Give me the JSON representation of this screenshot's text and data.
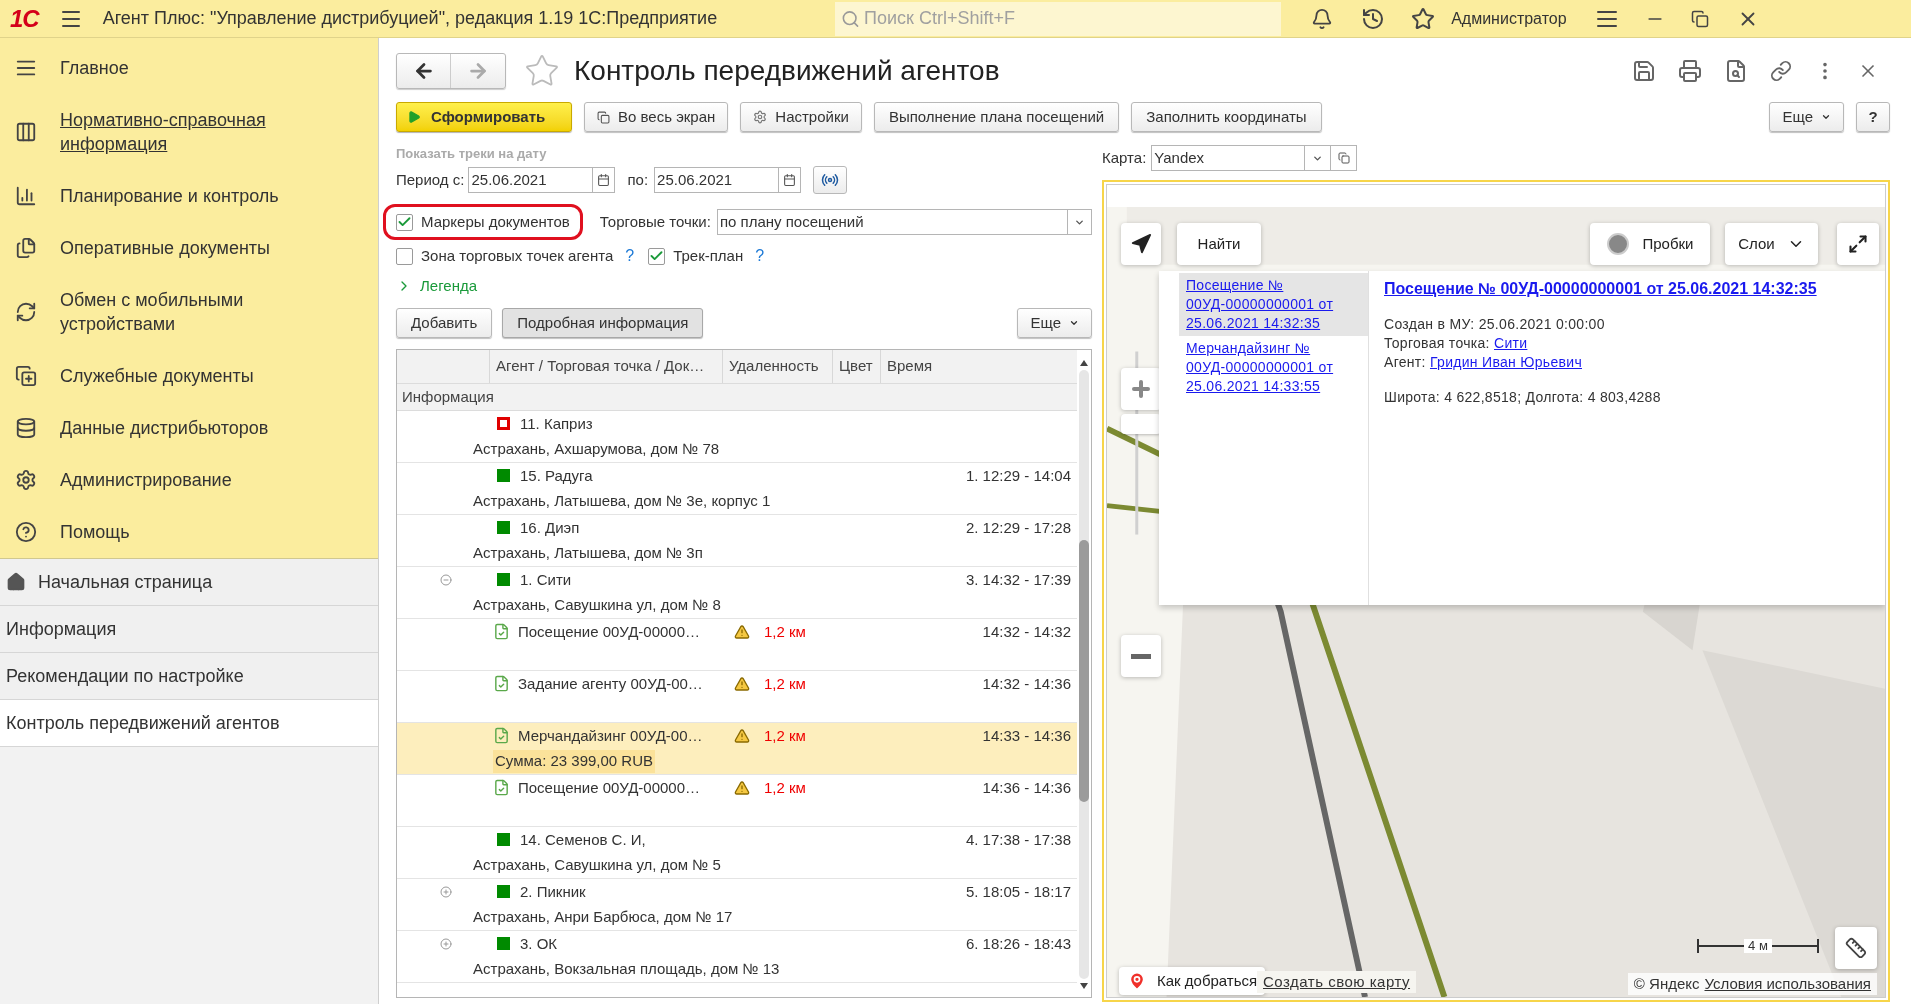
{
  "app_bar": {
    "logo": "1С",
    "title": "Агент Плюс: \"Управление дистрибуцией\", редакция 1.19 1С:Предприятие",
    "search": {
      "placeholder": "Поиск Ctrl+Shift+F"
    },
    "user": "Администратор"
  },
  "sidebar": {
    "sections": [
      {
        "label": "Главное",
        "underlined": false
      },
      {
        "label": "Нормативно-справочная информация",
        "underlined": true
      },
      {
        "label": "Планирование и контроль",
        "underlined": false
      },
      {
        "label": "Оперативные документы",
        "underlined": false
      },
      {
        "label": "Обмен с мобильными устройствами",
        "underlined": false
      },
      {
        "label": "Служебные документы",
        "underlined": false
      },
      {
        "label": "Данные дистрибьюторов",
        "underlined": false
      },
      {
        "label": "Администрирование",
        "underlined": false
      },
      {
        "label": "Помощь",
        "underlined": false
      }
    ],
    "open_pages": [
      {
        "label": "Начальная страница",
        "kind": "home",
        "selected": false
      },
      {
        "label": "Информация",
        "kind": "page",
        "selected": false
      },
      {
        "label": "Рекомендации по настройке",
        "kind": "page",
        "selected": false
      },
      {
        "label": "Контроль передвижений агентов",
        "kind": "page",
        "selected": true
      }
    ]
  },
  "form": {
    "title": "Контроль передвижений агентов",
    "favorite": false,
    "toolbar": [
      {
        "label": "Сформировать",
        "kind": "primary"
      },
      {
        "label": "Во весь экран",
        "kind": "window"
      },
      {
        "label": "Настройки",
        "kind": "settings"
      },
      {
        "label": "Выполнение плана посещений",
        "kind": "plain"
      },
      {
        "label": "Заполнить координаты",
        "kind": "plain"
      }
    ],
    "more": "Еще",
    "help": "?",
    "filters": {
      "caption": "Показать треки на дату",
      "from_label": "Период с:",
      "from_value": "25.06.2021",
      "to_label": "по:",
      "to_value": "25.06.2021",
      "checkboxes": [
        {
          "label": "Маркеры документов",
          "checked": true,
          "highlighted": true
        },
        {
          "label": "Зона торговых точек агента",
          "checked": false,
          "highlighted": false,
          "hint": "?"
        },
        {
          "label": "Трек-план",
          "checked": true,
          "highlighted": false,
          "hint": "?"
        }
      ],
      "points_label": "Торговые точки:",
      "points_value": "по плану посещений"
    },
    "legend": {
      "label": "Легенда",
      "expanded": false
    },
    "table_toolbar": [
      {
        "label": "Добавить",
        "pressed": false
      },
      {
        "label": "Подробная информация",
        "pressed": true
      }
    ],
    "table_more": "Еще",
    "table": {
      "columns": [
        "Агент / Торговая точка / Док…",
        "Удаленность",
        "Цвет",
        "Время"
      ],
      "group": "Информация",
      "rows": [
        {
          "kind": "point",
          "name": "11. Каприз",
          "address": "Астрахань, Ахшарумова, дом № 78",
          "time": "",
          "filled": false,
          "color": "#e00000"
        },
        {
          "kind": "point",
          "name": "15. Радуга",
          "address": "Астрахань, Латышева, дом № 3е, корпус 1",
          "time": "1. 12:29 - 14:04",
          "filled": true,
          "color": "#008a00"
        },
        {
          "kind": "point",
          "name": "16. Диэп",
          "address": "Астрахань, Латышева, дом № 3п",
          "time": "2. 12:29 - 17:28",
          "filled": true,
          "color": "#008a00"
        },
        {
          "kind": "point",
          "name": "1. Сити",
          "address": "Астрахань, Савушкина ул, дом № 8",
          "time": "3. 14:32 - 17:39",
          "filled": true,
          "color": "#008a00",
          "expanded": true
        },
        {
          "kind": "doc",
          "name": "Посещение 00УД-00000…",
          "distance": "1,2 км",
          "time": "14:32 - 14:32",
          "selected": false
        },
        {
          "kind": "doc",
          "name": "Задание агенту 00УД-00…",
          "distance": "1,2 км",
          "time": "14:32 - 14:36",
          "selected": false
        },
        {
          "kind": "doc",
          "name": "Мерчандайзинг 00УД-00…",
          "distance": "1,2 км",
          "time": "14:33 - 14:36",
          "selected": true,
          "sum": "Сумма: 23 399,00 RUB"
        },
        {
          "kind": "doc",
          "name": "Посещение 00УД-00000…",
          "distance": "1,2 км",
          "time": "14:36 - 14:36",
          "selected": false
        },
        {
          "kind": "point",
          "name": "14. Семенов С. И,",
          "address": "Астрахань, Савушкина ул, дом № 5",
          "time": "4. 17:38 - 17:38",
          "filled": true,
          "color": "#008a00"
        },
        {
          "kind": "point",
          "name": "2. Пикник",
          "address": "Астрахань, Анри Барбюса, дом № 17",
          "time": "5. 18:05 - 18:17",
          "filled": true,
          "color": "#008a00",
          "expanded": false
        },
        {
          "kind": "point",
          "name": "3. ОК",
          "address": "Астрахань, Вокзальная площадь, дом № 13",
          "time": "6. 18:26 - 18:43",
          "filled": true,
          "color": "#008a00",
          "expanded": false
        }
      ]
    },
    "map": {
      "label": "Карта:",
      "value": "Yandex",
      "find": "Найти",
      "traffic": "Пробки",
      "layers": "Слои",
      "route": "Как добраться",
      "create": "Создать свою карту",
      "copyright": "© Яндекс",
      "terms": "Условия использования",
      "scale": "4 м",
      "popup": {
        "list": [
          {
            "text": "Посещение № 00УД-00000000001 от 25.06.2021 14:32:35",
            "selected": true
          },
          {
            "text": "Мерчандайзинг № 00УД-00000000001 от 25.06.2021 14:33:55",
            "selected": false
          }
        ],
        "heading": "Посещение № 00УД-00000000001 от 25.06.2021 14:32:35",
        "lines": [
          {
            "label": "Создан в МУ: 25.06.2021 0:00:00"
          },
          {
            "label": "Торговая точка:",
            "link": "Сити"
          },
          {
            "label": "Агент:",
            "link": "Гридин Иван Юрьевич"
          }
        ],
        "coords": "Широта: 4 622,8518; Долгота: 4 803,4288"
      }
    }
  }
}
